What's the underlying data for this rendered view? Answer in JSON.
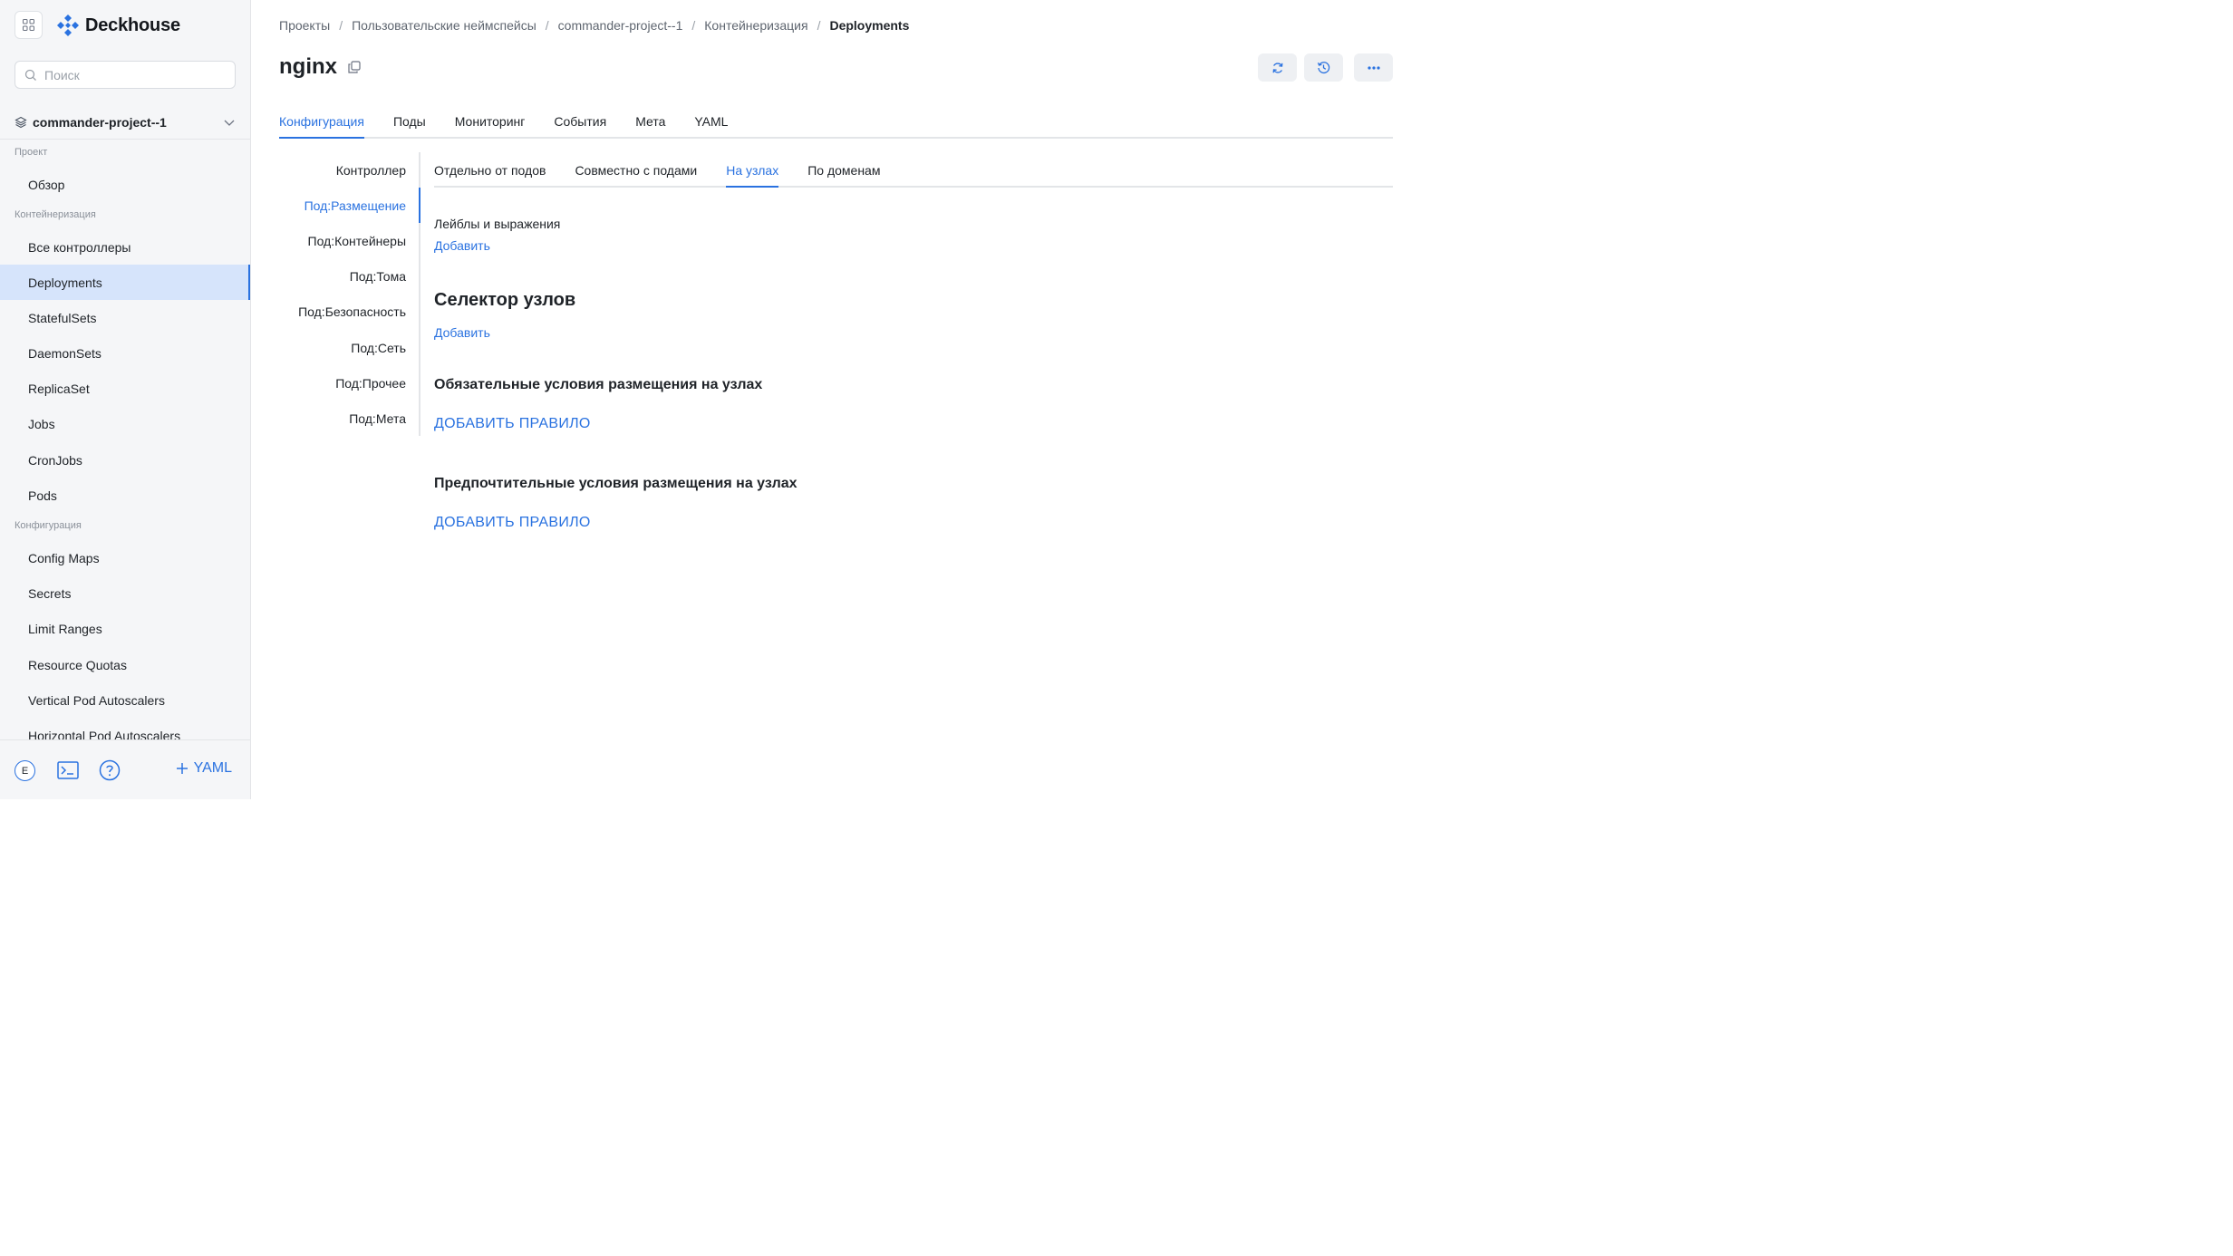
{
  "app": {
    "name": "Deckhouse"
  },
  "search": {
    "placeholder": "Поиск"
  },
  "project": {
    "name": "commander-project--1"
  },
  "sidebar": {
    "sections": [
      {
        "label": "Проект"
      },
      {
        "label": "Контейнеризация"
      },
      {
        "label": "Конфигурация"
      }
    ],
    "items": [
      {
        "label": "Обзор"
      },
      {
        "label": "Все контроллеры"
      },
      {
        "label": "Deployments"
      },
      {
        "label": "StatefulSets"
      },
      {
        "label": "DaemonSets"
      },
      {
        "label": "ReplicaSet"
      },
      {
        "label": "Jobs"
      },
      {
        "label": "CronJobs"
      },
      {
        "label": "Pods"
      },
      {
        "label": "Config Maps"
      },
      {
        "label": "Secrets"
      },
      {
        "label": "Limit Ranges"
      },
      {
        "label": "Resource Quotas"
      },
      {
        "label": "Vertical Pod Autoscalers"
      },
      {
        "label": "Horizontal Pod Autoscalers"
      }
    ],
    "active_item": "Deployments",
    "avatar_letter": "E",
    "yaml_label": "YAML"
  },
  "breadcrumb": [
    {
      "label": "Проекты"
    },
    {
      "label": "Пользовательские неймспейсы"
    },
    {
      "label": "commander-project--1"
    },
    {
      "label": "Контейнеризация"
    },
    {
      "label": "Deployments"
    }
  ],
  "page": {
    "title": "nginx"
  },
  "tabs": [
    {
      "label": "Конфигурация",
      "active": true
    },
    {
      "label": "Поды"
    },
    {
      "label": "Мониторинг"
    },
    {
      "label": "События"
    },
    {
      "label": "Мета"
    },
    {
      "label": "YAML"
    }
  ],
  "subnav": [
    {
      "label": "Контроллер"
    },
    {
      "label": "Под:Размещение",
      "active": true
    },
    {
      "label": "Под:Контейнеры"
    },
    {
      "label": "Под:Тома"
    },
    {
      "label": "Под:Безопасность"
    },
    {
      "label": "Под:Сеть"
    },
    {
      "label": "Под:Прочее"
    },
    {
      "label": "Под:Мета"
    }
  ],
  "subtabs": [
    {
      "label": "Отдельно от подов"
    },
    {
      "label": "Совместно с подами"
    },
    {
      "label": "На узлах",
      "active": true
    },
    {
      "label": "По доменам"
    }
  ],
  "content": {
    "labels_title": "Лейблы и выражения",
    "add_label": "Добавить",
    "node_selector_title": "Селектор узлов",
    "add_selector": "Добавить",
    "required_title": "Обязательные условия размещения на узлах",
    "add_required_rule": "ДОБАВИТЬ ПРАВИЛО",
    "preferred_title": "Предпочтительные условия размещения на узлах",
    "add_preferred_rule": "ДОБАВИТЬ ПРАВИЛО"
  },
  "colors": {
    "accent": "#2a72e0",
    "active_bg": "#d6e4fb",
    "sidebar_bg": "#f5f6f8"
  }
}
